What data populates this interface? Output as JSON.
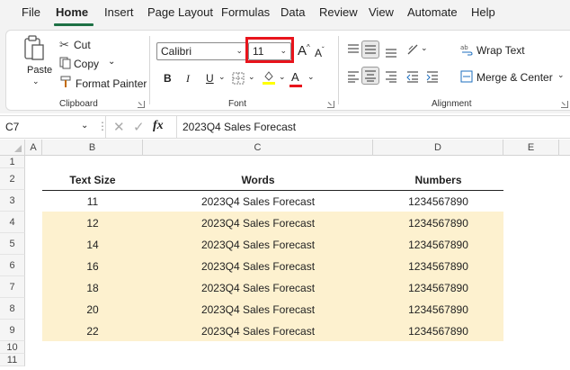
{
  "menu": {
    "items": [
      "File",
      "Home",
      "Insert",
      "Page Layout",
      "Formulas",
      "Data",
      "Review",
      "View",
      "Automate",
      "Help"
    ],
    "active": "Home"
  },
  "clipboard": {
    "paste_label": "Paste",
    "cut_label": "Cut",
    "copy_label": "Copy",
    "format_painter_label": "Format Painter",
    "group_label": "Clipboard"
  },
  "font": {
    "name": "Calibri",
    "size": "11",
    "bold": "B",
    "italic": "I",
    "underline": "U",
    "grow": "A",
    "shrink": "A",
    "color_letter": "A",
    "group_label": "Font",
    "fill_color": "#ffff00",
    "font_color": "#e8141c",
    "highlight_color": "#e8141c"
  },
  "alignment": {
    "wrap_text_label": "Wrap Text",
    "merge_center_label": "Merge & Center",
    "group_label": "Alignment"
  },
  "formula_bar": {
    "cell_ref": "C7",
    "fx": "fx",
    "formula": "2023Q4 Sales Forecast"
  },
  "sheet": {
    "columns": [
      "A",
      "B",
      "C",
      "D",
      "E"
    ],
    "rows": [
      "1",
      "2",
      "3",
      "4",
      "5",
      "6",
      "7",
      "8",
      "9",
      "10",
      "11"
    ],
    "table_headers": [
      "Text Size",
      "Words",
      "Numbers"
    ],
    "table_rows": [
      [
        "11",
        "2023Q4 Sales Forecast",
        "1234567890"
      ],
      [
        "12",
        "2023Q4 Sales Forecast",
        "1234567890"
      ],
      [
        "14",
        "2023Q4 Sales Forecast",
        "1234567890"
      ],
      [
        "16",
        "2023Q4 Sales Forecast",
        "1234567890"
      ],
      [
        "18",
        "2023Q4 Sales Forecast",
        "1234567890"
      ],
      [
        "20",
        "2023Q4 Sales Forecast",
        "1234567890"
      ],
      [
        "22",
        "2023Q4 Sales Forecast",
        "1234567890"
      ]
    ],
    "shade_color": "#fdf1cf"
  }
}
